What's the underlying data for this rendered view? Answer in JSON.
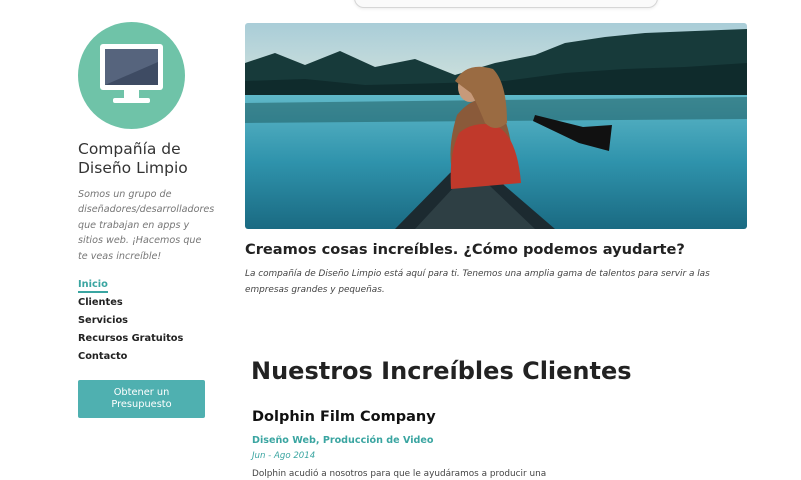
{
  "brand": {
    "company_name": "Compañía de Diseño Limpio",
    "tagline": "Somos un grupo de diseñadores/desarrolladores que trabajan en apps y sitios web. ¡Hacemos que te veas increíble!",
    "logo_icon": "monitor-icon",
    "logo_color": "#6fc3a8"
  },
  "nav": {
    "items": [
      {
        "label": "Inicio",
        "active": true
      },
      {
        "label": "Clientes",
        "active": false
      },
      {
        "label": "Servicios",
        "active": false
      },
      {
        "label": "Recursos Gratuitos",
        "active": false
      },
      {
        "label": "Contacto",
        "active": false
      }
    ]
  },
  "cta": {
    "quote_label": "Obtener un Presupuesto"
  },
  "hero": {
    "title": "Creamos cosas increíbles. ¿Cómo podemos ayudarte?",
    "description": "La compañía de Diseño Limpio está aquí para ti. Tenemos una amplia gama de talentos para servir a las empresas grandes y pequeñas."
  },
  "clients": {
    "section_title": "Nuestros Increíbles Clientes",
    "items": [
      {
        "name": "Dolphin Film Company",
        "services": "Diseño Web, Producción de Video",
        "dates": "Jun - Ago 2014",
        "description": "Dolphin acudió a nosotros para que le ayudáramos a producir una"
      }
    ]
  },
  "colors": {
    "accent": "#3aa5a1",
    "button": "#4fb0b0",
    "text": "#222222"
  }
}
